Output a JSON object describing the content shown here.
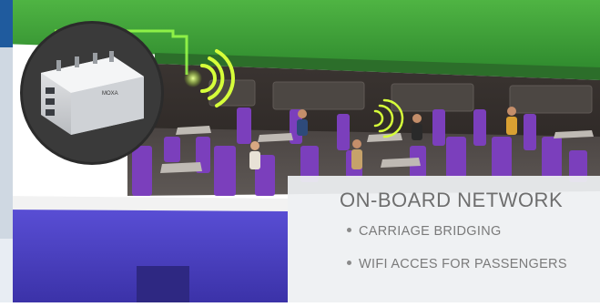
{
  "caption": {
    "title": "ON-BOARD NETWORK",
    "bullets": [
      "CARRIAGE BRIDGING",
      "WIFI ACCES FOR PASSENGERS"
    ]
  },
  "device_label": "MOXA",
  "colors": {
    "roof_green": "#3fa23a",
    "seat_purple": "#7a3fb8",
    "carriage_blue": "#4a3fc0",
    "wifi_glow": "#c8ff3a",
    "interior_dark": "#2e2a28"
  },
  "icons": [
    "wifi-signal-icon",
    "wifi-signal-icon-small"
  ]
}
